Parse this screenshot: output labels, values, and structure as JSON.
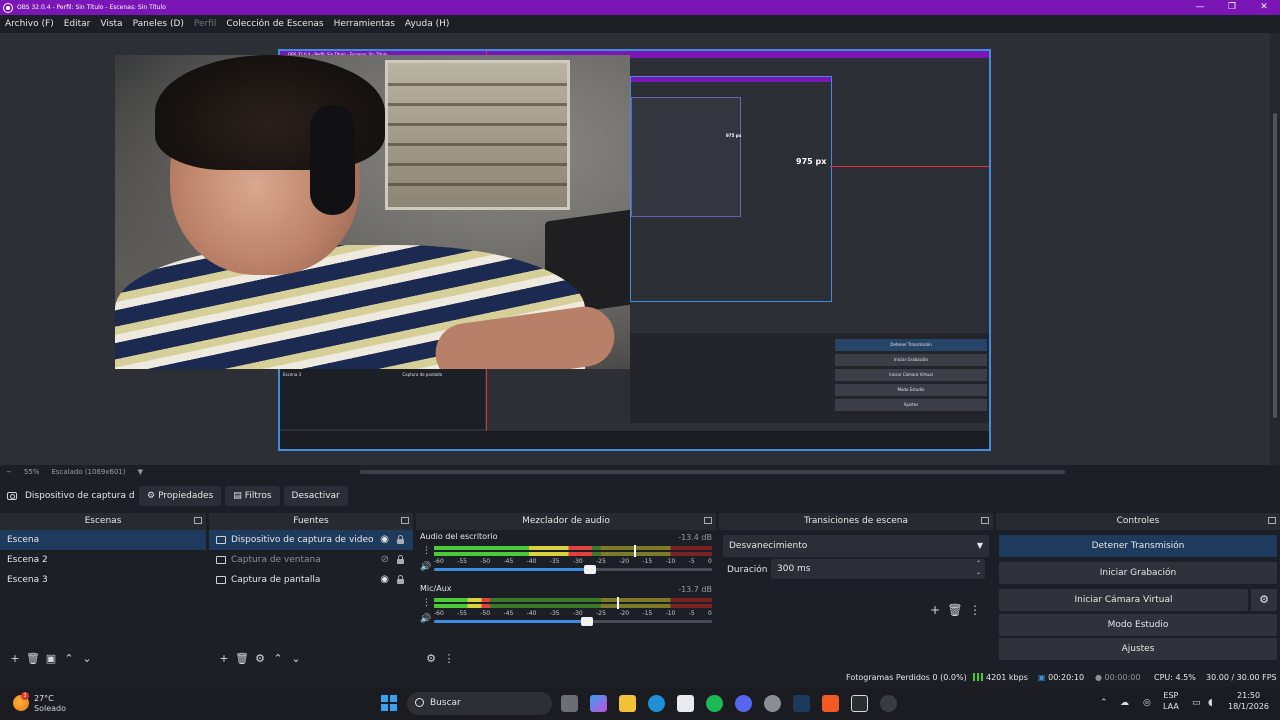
{
  "window": {
    "title": "OBS 32.0.4 - Perfil: Sin Título - Escenas: Sin Título",
    "controls": [
      "—",
      "❐",
      "✕"
    ]
  },
  "menu": [
    "Archivo (F)",
    "Editar",
    "Vista",
    "Paneles (D)",
    "Perfil",
    "Colección de Escenas",
    "Herramientas",
    "Ayuda (H)"
  ],
  "preview": {
    "measure_label": "975 px",
    "nested_measure_label": "975 px",
    "nested_window_title": "OBS 32.0.4 - Perfil: Sin Título - Escenas: Sin Título",
    "nested_scene": "Escena 3",
    "nested_source": "Captura de pantalla",
    "nested_controls": [
      "Detener Transmisión",
      "Iniciar Grabación",
      "Iniciar Cámara Virtual",
      "Modo Estudio",
      "Ajustes"
    ]
  },
  "zoom": {
    "minus": "−",
    "percent": "55%",
    "scale": "Escalado (1069x601)",
    "dropdown": "▼"
  },
  "source_toolbar": {
    "selected_source": "Dispositivo de captura de v",
    "properties": "Propiedades",
    "filters": "Filtros",
    "deactivate": "Desactivar"
  },
  "docks": {
    "scenes": {
      "title": "Escenas",
      "items": [
        "Escena",
        "Escena 2",
        "Escena 3"
      ],
      "selected_index": 0,
      "toolbar": [
        "+",
        "🗑",
        "▣",
        "⌃",
        "⌄"
      ]
    },
    "sources": {
      "title": "Fuentes",
      "items": [
        {
          "label": "Dispositivo de captura de video",
          "visible": true
        },
        {
          "label": "Captura de ventana",
          "visible": false
        },
        {
          "label": "Captura de pantalla",
          "visible": true
        }
      ],
      "toolbar": [
        "+",
        "🗑",
        "⚙",
        "⌃",
        "⌄"
      ]
    },
    "mixer": {
      "title": "Mezclador de audio",
      "channels": [
        {
          "name": "Audio del escritorio",
          "db": "-13.4 dB",
          "level": 0.57,
          "peak": 0.72,
          "volume": 0.56
        },
        {
          "name": "Mic/Aux",
          "db": "-13.7 dB",
          "level": 0.2,
          "peak": 0.66,
          "volume": 0.55
        }
      ],
      "ticks": [
        "-60",
        "-55",
        "-50",
        "-45",
        "-40",
        "-35",
        "-30",
        "-25",
        "-20",
        "-15",
        "-10",
        "-5",
        "0"
      ],
      "toolbar": [
        "⚙",
        "⋮"
      ]
    },
    "transitions": {
      "title": "Transiciones de escena",
      "selected": "Desvanecimiento",
      "duration_label": "Duración",
      "duration_value": "300 ms",
      "tools": [
        "+",
        "🗑",
        "⋮"
      ]
    },
    "controls": {
      "title": "Controles",
      "buttons": [
        "Detener Transmisión",
        "Iniciar Grabación",
        "Iniciar Cámara Virtual",
        "Modo Estudio",
        "Ajustes"
      ],
      "gear": "⚙"
    }
  },
  "status": {
    "dropped_frames": "Fotogramas Perdidos 0 (0.0%)",
    "bitrate": "4201 kbps",
    "stream_time": "00:20:10",
    "rec_time": "00:00:00",
    "cpu": "CPU: 4.5%",
    "fps": "30.00 / 30.00 FPS"
  },
  "taskbar": {
    "weather_temp": "27°C",
    "weather_cond": "Soleado",
    "weather_badge": "2",
    "search": "Buscar",
    "lang_top": "ESP",
    "lang_bottom": "LAA",
    "time": "21:50",
    "date": "18/1/2026"
  },
  "colors": {
    "title_bar": "#7a16b5",
    "accent": "#3f8de0",
    "selection": "#1e3b5e",
    "measure_line": "#e0303a"
  }
}
